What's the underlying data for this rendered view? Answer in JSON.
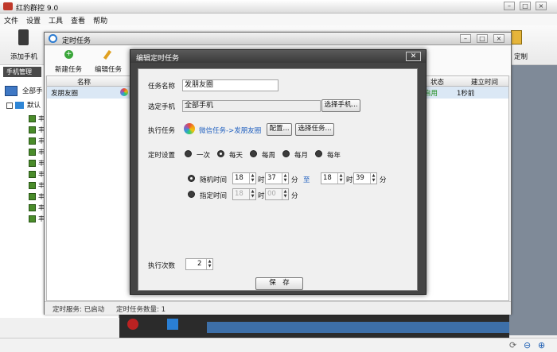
{
  "app": {
    "title": "红豹群控 9.0"
  },
  "menu": [
    "文件",
    "设置",
    "工具",
    "查看",
    "帮助"
  ],
  "toolbar": {
    "add_phone": "添加手机",
    "right_label": "定制"
  },
  "left_panel": {
    "tab": "手机管理",
    "all_phones": "全部手",
    "default_group": "默认",
    "child_label": "丰"
  },
  "timer_window": {
    "title": "定时任务",
    "new_task": "新建任务",
    "edit_task": "编辑任务",
    "columns": [
      "名称",
      "状态",
      "建立时间"
    ],
    "rows": [
      {
        "name": "发朋友圈",
        "status": "启用",
        "created": "1秒前"
      }
    ],
    "status_service": "定时服务: 已启动",
    "status_count": "定时任务数量: 1"
  },
  "dialog": {
    "title": "编辑定时任务",
    "task_name_label": "任务名称",
    "task_name_value": "发朋友圈",
    "phone_label": "选定手机",
    "phone_value": "全部手机",
    "select_phone_btn": "选择手机...",
    "exec_label": "执行任务",
    "exec_value": "微信任务->发朋友圈",
    "config_btn": "配置...",
    "select_task_btn": "选择任务...",
    "schedule_label": "定时设置",
    "schedule_options": [
      "一次",
      "每天",
      "每周",
      "每月",
      "每年"
    ],
    "schedule_selected": "每天",
    "random_label": "随机时间",
    "random_from_h": "18",
    "random_from_m": "37",
    "to_label": "至",
    "random_to_h": "18",
    "random_to_m": "39",
    "fixed_label": "指定时间",
    "fixed_h": "18",
    "fixed_m": "00",
    "hour_unit": "时",
    "min_unit": "分",
    "count_label": "执行次数",
    "count_value": "2",
    "save_btn": "保　存"
  }
}
